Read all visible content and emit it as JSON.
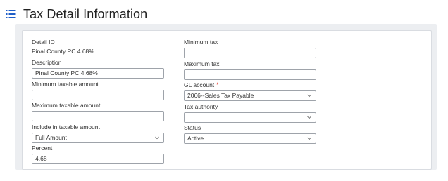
{
  "header": {
    "title": "Tax Detail Information",
    "icon": "list-icon"
  },
  "left": {
    "detail_id": {
      "label": "Detail ID",
      "value": "Pinal County PC 4.68%"
    },
    "description": {
      "label": "Description",
      "value": "Pinal County PC 4.68%"
    },
    "min_taxable": {
      "label": "Minimum taxable amount",
      "value": ""
    },
    "max_taxable": {
      "label": "Maximum taxable amount",
      "value": ""
    },
    "include_taxable": {
      "label": "Include in taxable amount",
      "value": "Full Amount"
    },
    "percent": {
      "label": "Percent",
      "value": "4.68"
    }
  },
  "right": {
    "min_tax": {
      "label": "Minimum tax",
      "value": ""
    },
    "max_tax": {
      "label": "Maximum tax",
      "value": ""
    },
    "gl_account": {
      "label": "GL account",
      "required_mark": "*",
      "value": "2066--Sales Tax Payable"
    },
    "tax_authority": {
      "label": "Tax authority",
      "value": ""
    },
    "status": {
      "label": "Status",
      "value": "Active"
    }
  },
  "colors": {
    "accent": "#1f5ec8",
    "required": "#e33a2b",
    "border": "#9ea3aa"
  }
}
